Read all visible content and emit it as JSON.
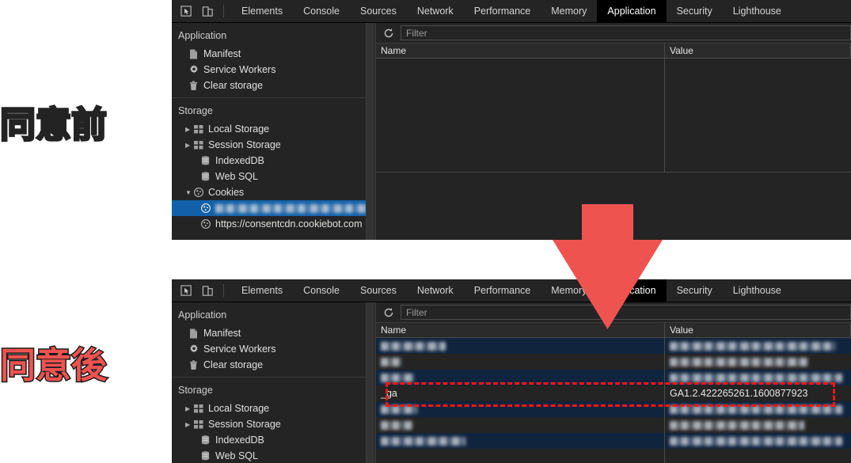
{
  "annotations": {
    "before_label": "同意前",
    "after_label": "同意後",
    "arrow_color": "#ef5350",
    "highlight_color": "#fb1616"
  },
  "devtools": {
    "tabs": [
      "Elements",
      "Console",
      "Sources",
      "Network",
      "Performance",
      "Memory",
      "Application",
      "Security",
      "Lighthouse"
    ],
    "active_tab": "Application",
    "icons": {
      "inspect": "inspect-element-icon",
      "device": "device-toolbar-icon",
      "refresh": "refresh-icon"
    },
    "sidebar": {
      "application_title": "Application",
      "application_items": [
        {
          "label": "Manifest",
          "icon": "document-icon"
        },
        {
          "label": "Service Workers",
          "icon": "gear-icon"
        },
        {
          "label": "Clear storage",
          "icon": "trash-icon"
        }
      ],
      "storage_title": "Storage",
      "storage_items": [
        {
          "label": "Local Storage",
          "icon": "table-icon",
          "twisty": "collapsed"
        },
        {
          "label": "Session Storage",
          "icon": "table-icon",
          "twisty": "collapsed"
        },
        {
          "label": "IndexedDB",
          "icon": "database-icon",
          "twisty": "none"
        },
        {
          "label": "Web SQL",
          "icon": "database-icon",
          "twisty": "none"
        },
        {
          "label": "Cookies",
          "icon": "cookie-icon",
          "twisty": "expanded"
        }
      ],
      "cookie_children": [
        {
          "label": "",
          "icon": "cookie-icon",
          "redacted": true,
          "selected": true,
          "blur_width": 210
        },
        {
          "label": "https://consentcdn.cookiebot.com",
          "icon": "cookie-icon",
          "redacted": false,
          "selected": false
        }
      ]
    },
    "filter": {
      "placeholder": "Filter",
      "value": ""
    },
    "table": {
      "columns": [
        "Name",
        "Value"
      ]
    }
  },
  "panel_before": {
    "caption": "同意前",
    "rows": []
  },
  "panel_after": {
    "caption": "同意後",
    "rows": [
      {
        "name": "",
        "value": "",
        "redacted": true,
        "selected": true,
        "name_blur": 82,
        "value_blur": 210
      },
      {
        "name": "",
        "value": "",
        "redacted": true,
        "selected": false,
        "name_blur": 26,
        "value_blur": 175
      },
      {
        "name": "",
        "value": "",
        "redacted": true,
        "selected": true,
        "name_blur": 42,
        "value_blur": 218
      },
      {
        "name": "_ga",
        "value": "GA1.2.422265261.1600877923",
        "redacted": false,
        "selected": false,
        "highlighted": true
      },
      {
        "name": "",
        "value": "",
        "redacted": true,
        "selected": true,
        "name_blur": 46,
        "value_blur": 218
      },
      {
        "name": "",
        "value": "",
        "redacted": true,
        "selected": false,
        "name_blur": 40,
        "value_blur": 170
      },
      {
        "name": "",
        "value": "",
        "redacted": true,
        "selected": true,
        "name_blur": 107,
        "value_blur": 218
      }
    ]
  }
}
